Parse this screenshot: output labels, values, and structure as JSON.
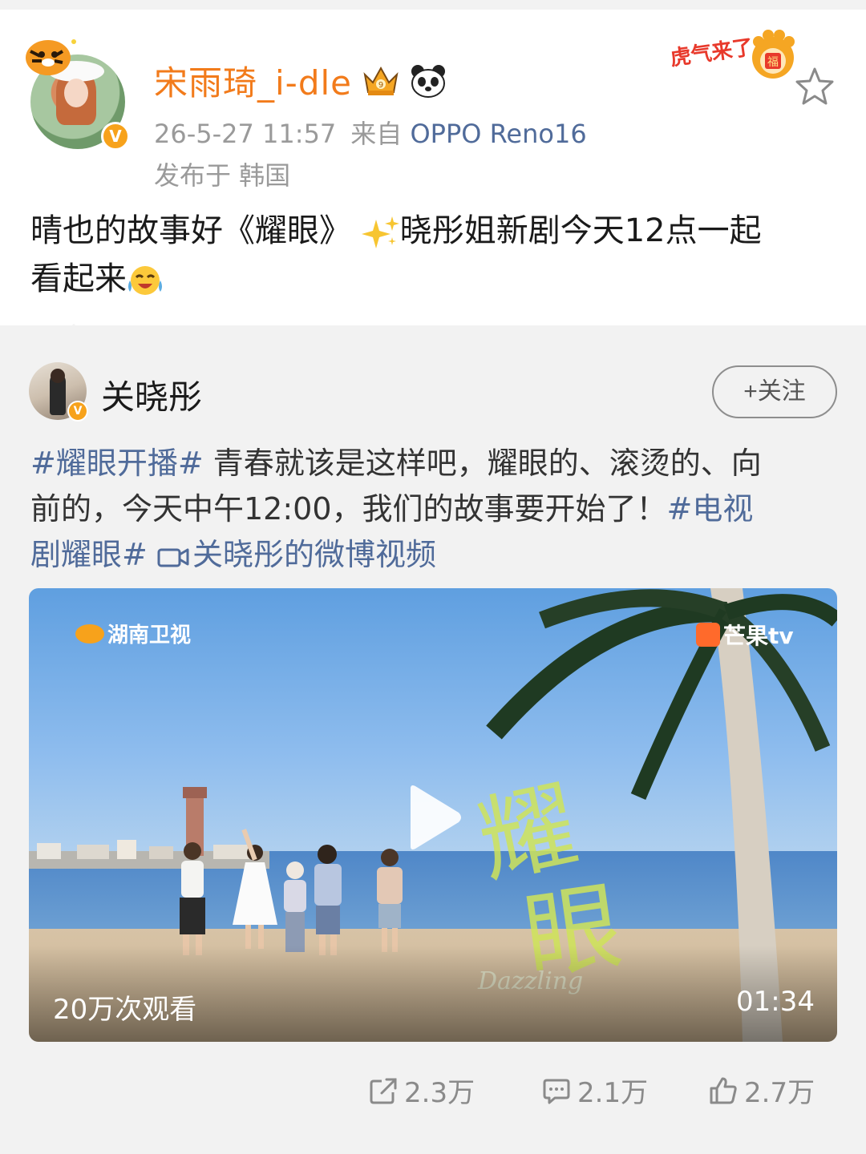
{
  "post": {
    "username": "宋雨琦_i-dle",
    "timestamp": "26-5-27 11:57",
    "source_prefix": "来自",
    "source_device": "OPPO Reno16",
    "location": "发布于 韩国",
    "text_line1": "晴也的故事好《耀眼》",
    "text_line1b": "晓彤姐新剧今天12点一起",
    "text_line2": "看起来",
    "verified_badge": "V",
    "badge_text": "虎气来了",
    "badge_fu": "福"
  },
  "repost": {
    "name": "关晓彤",
    "follow_label": "+关注",
    "verified_badge": "V",
    "tag1": "#耀眼开播#",
    "text_a": " 青春就该是这样吧，耀眼的、滚烫的、向",
    "text_b": "前的，今天中午12:00，我们的故事要开始了！",
    "tag2a": "#电视",
    "tag2b": "剧耀眼#",
    "video_link": "关晓彤的微博视频"
  },
  "video": {
    "channel_logo": "湖南卫视",
    "platform_logo": "芒果tv",
    "title_art": "耀眼",
    "title_sub": "Dazzling",
    "views": "20万次观看",
    "duration": "01:34"
  },
  "actions": {
    "repost_count": "2.3万",
    "comment_count": "2.1万",
    "like_count": "2.7万"
  },
  "colors": {
    "username": "#f27b1b",
    "link": "#506b9a",
    "meta": "#9a9a9a",
    "background": "#f2f2f2"
  }
}
